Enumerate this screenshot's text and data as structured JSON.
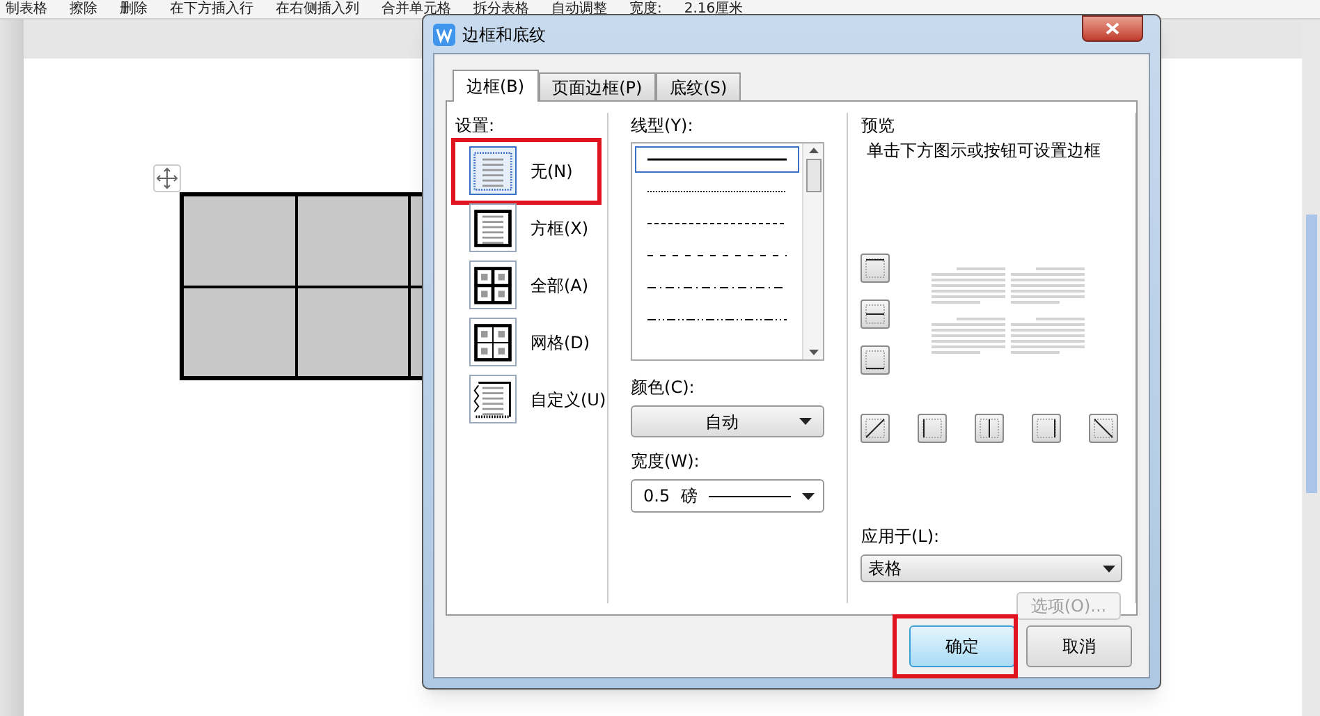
{
  "toolbar": {
    "items": [
      "制表格",
      "擦除",
      "删除",
      "在下方插入行",
      "在右侧插入列",
      "合并单元格",
      "拆分表格",
      "自动调整",
      "宽度:",
      "2.16厘米"
    ]
  },
  "dialog": {
    "title": "边框和底纹",
    "tabs": [
      {
        "label": "边框(B)",
        "selected": true
      },
      {
        "label": "页面边框(P)",
        "selected": false
      },
      {
        "label": "底纹(S)",
        "selected": false
      }
    ],
    "settings": {
      "label": "设置:",
      "items": [
        {
          "label": "无(N)",
          "kind": "none",
          "selected": true,
          "highlighted": true
        },
        {
          "label": "方框(X)",
          "kind": "box",
          "selected": false,
          "highlighted": false
        },
        {
          "label": "全部(A)",
          "kind": "all",
          "selected": false,
          "highlighted": false
        },
        {
          "label": "网格(D)",
          "kind": "grid",
          "selected": false,
          "highlighted": false
        },
        {
          "label": "自定义(U)",
          "kind": "custom",
          "selected": false,
          "highlighted": false
        }
      ]
    },
    "line_style": {
      "label": "线型(Y):",
      "styles": [
        {
          "kind": "solid",
          "selected": true
        },
        {
          "kind": "dotted",
          "selected": false
        },
        {
          "kind": "dashed",
          "selected": false
        },
        {
          "kind": "dash-wide",
          "selected": false
        },
        {
          "kind": "dash-dot",
          "selected": false
        },
        {
          "kind": "dash-dot-dot",
          "selected": false
        }
      ]
    },
    "color": {
      "label": "颜色(C):",
      "value": "自动"
    },
    "width": {
      "label": "宽度(W):",
      "value": "0.5",
      "unit": "磅"
    },
    "preview": {
      "label": "预览",
      "hint": "单击下方图示或按钮可设置边框"
    },
    "apply_to": {
      "label": "应用于(L):",
      "value": "表格"
    },
    "options_button": {
      "label": "选项(O)...",
      "disabled": true
    },
    "buttons": [
      {
        "label": "确定",
        "default": true,
        "highlighted": true
      },
      {
        "label": "取消",
        "default": false,
        "highlighted": false
      }
    ]
  }
}
